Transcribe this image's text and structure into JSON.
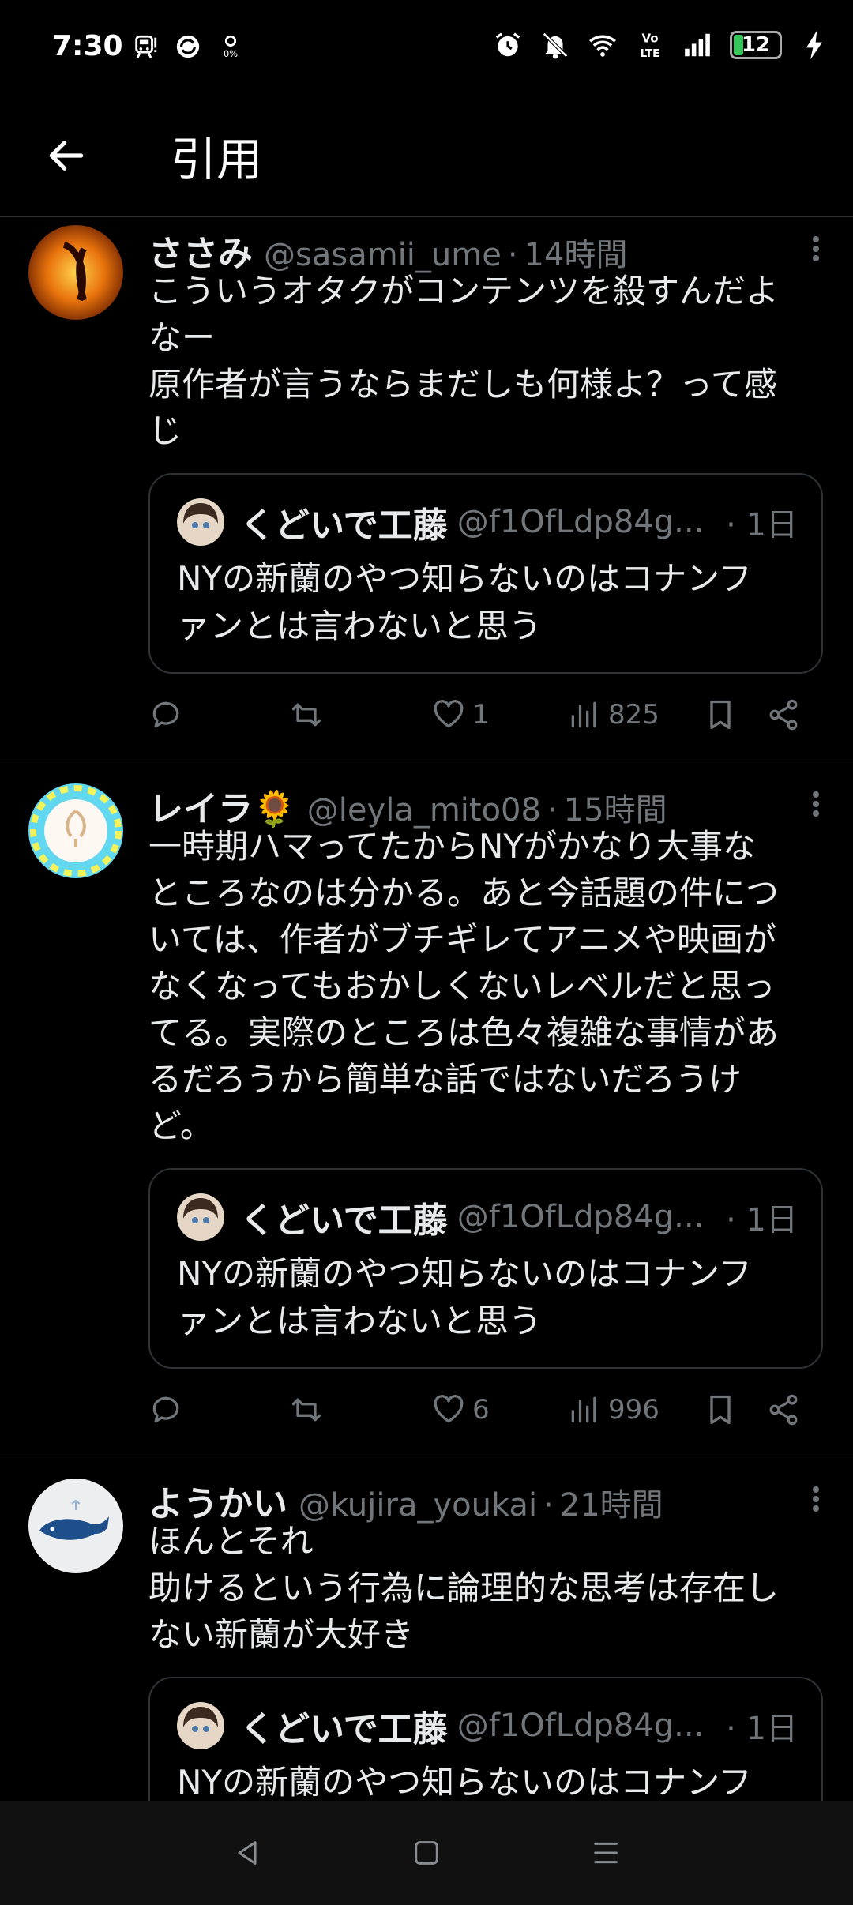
{
  "status_bar": {
    "time": "7:30",
    "battery": "12",
    "left_icons": [
      "train-icon",
      "sync-icon",
      "data-saver-icon"
    ],
    "right_icons": [
      "alarm-icon",
      "mute-bell-icon",
      "wifi-icon",
      "volte-icon",
      "signal-icon",
      "battery-icon",
      "charging-icon"
    ]
  },
  "header": {
    "title": "引用",
    "back_icon": "arrow-left-icon"
  },
  "colors": {
    "background": "#000000",
    "text": "#e7e9ea",
    "secondary": "#71767b",
    "divider": "#2f3336"
  },
  "tweets": [
    {
      "display_name": "ささみ",
      "handle": "@sasamii_ume",
      "dot": "·",
      "time": "14時間",
      "text": "こういうオタクがコンテンツを殺すんだよ\nなー\n原作者が言うならまだしも何様よ？って感\nじ",
      "quote": {
        "name": "くどいで工藤",
        "handle": "@f1OfLdp84g...",
        "time": "· 1日",
        "text": "NYの新蘭のやつ知らないのはコナンフ\nァンとは言わないと思う"
      },
      "stats": {
        "replies": "",
        "retweets": "",
        "likes": "1",
        "views": "825"
      }
    },
    {
      "display_name": "レイラ🌻",
      "handle": "@leyla_mito08",
      "dot": "·",
      "time": "15時間",
      "text": "一時期ハマってたからNYがかなり大事な\nところなのは分かる。あと今話題の件につ\nいては、作者がブチギレてアニメや映画が\nなくなってもおかしくないレベルだと思っ\nてる。実際のところは色々複雑な事情があ\nるだろうから簡単な話ではないだろうけ\nど。",
      "quote": {
        "name": "くどいで工藤",
        "handle": "@f1OfLdp84g...",
        "time": "· 1日",
        "text": "NYの新蘭のやつ知らないのはコナンフ\nァンとは言わないと思う"
      },
      "stats": {
        "replies": "",
        "retweets": "",
        "likes": "6",
        "views": "996"
      }
    },
    {
      "display_name": "ようかい",
      "handle": "@kujira_youkai",
      "dot": "·",
      "time": "21時間",
      "text": "ほんとそれ\n助けるという行為に論理的な思考は存在し\nない新蘭が大好き",
      "quote": {
        "name": "くどいで工藤",
        "handle": "@f1OfLdp84g...",
        "time": "· 1日",
        "text": "NYの新蘭のやつ知らないのはコナンフ\nァンとは言わないと思う"
      },
      "stats": {
        "replies": "",
        "retweets": "",
        "likes": "",
        "views": ""
      }
    }
  ],
  "nav": {
    "back": "nav-back-icon",
    "home": "nav-home-icon",
    "recents": "nav-recents-icon"
  }
}
